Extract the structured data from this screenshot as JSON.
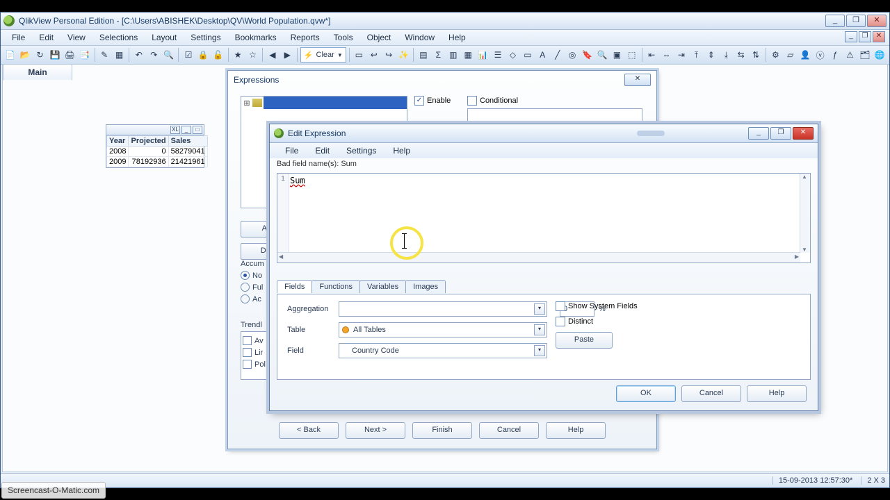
{
  "app": {
    "title": "QlikView Personal Edition - [C:\\Users\\ABISHEK\\Desktop\\QV\\World Population.qvw*]"
  },
  "menu": {
    "items": [
      "File",
      "Edit",
      "View",
      "Selections",
      "Layout",
      "Settings",
      "Bookmarks",
      "Reports",
      "Tools",
      "Object",
      "Window",
      "Help"
    ]
  },
  "toolbar": {
    "clear_label": "Clear"
  },
  "sheet": {
    "active_tab": "Main"
  },
  "tablebox": {
    "headers": [
      "Year",
      "Projected",
      "Sales"
    ],
    "rows": [
      [
        "2008",
        "0",
        "58279041"
      ],
      [
        "2009",
        "78192936",
        "21421961"
      ]
    ]
  },
  "wizard": {
    "title": "Expressions",
    "enable_label": "Enable",
    "enable_checked": true,
    "conditional_label": "Conditional",
    "conditional_checked": false,
    "btn_add": "Ac",
    "btn_delete": "Del",
    "accum_label": "Accum",
    "accum_options": [
      "No",
      "Ful",
      "Ac"
    ],
    "accum_selected": 0,
    "trend_label": "Trendl",
    "trend_items": [
      "Av",
      "Lir",
      "Pol"
    ],
    "buttons": {
      "back": "< Back",
      "next": "Next >",
      "finish": "Finish",
      "cancel": "Cancel",
      "help": "Help"
    }
  },
  "editExpression": {
    "title": "Edit Expression",
    "menu": [
      "File",
      "Edit",
      "Settings",
      "Help"
    ],
    "status": "Bad field name(s): Sum",
    "gutter_line": "1",
    "editor_text": "Sum",
    "tabs": [
      "Fields",
      "Functions",
      "Variables",
      "Images"
    ],
    "active_tab": 0,
    "form": {
      "aggregation_label": "Aggregation",
      "aggregation_value": "",
      "table_label": "Table",
      "table_value": "All Tables",
      "field_label": "Field",
      "field_value": "Country Code",
      "percent_value": "0",
      "percent_symbol": "%",
      "show_system_label": "Show System Fields",
      "show_system_checked": false,
      "distinct_label": "Distinct",
      "distinct_checked": false,
      "paste_label": "Paste"
    },
    "buttons": {
      "ok": "OK",
      "cancel": "Cancel",
      "help": "Help"
    }
  },
  "statusbar": {
    "datetime": "15-09-2013 12:57:30*",
    "dims": "2 X 3"
  },
  "watermark": "Screencast-O-Matic.com"
}
